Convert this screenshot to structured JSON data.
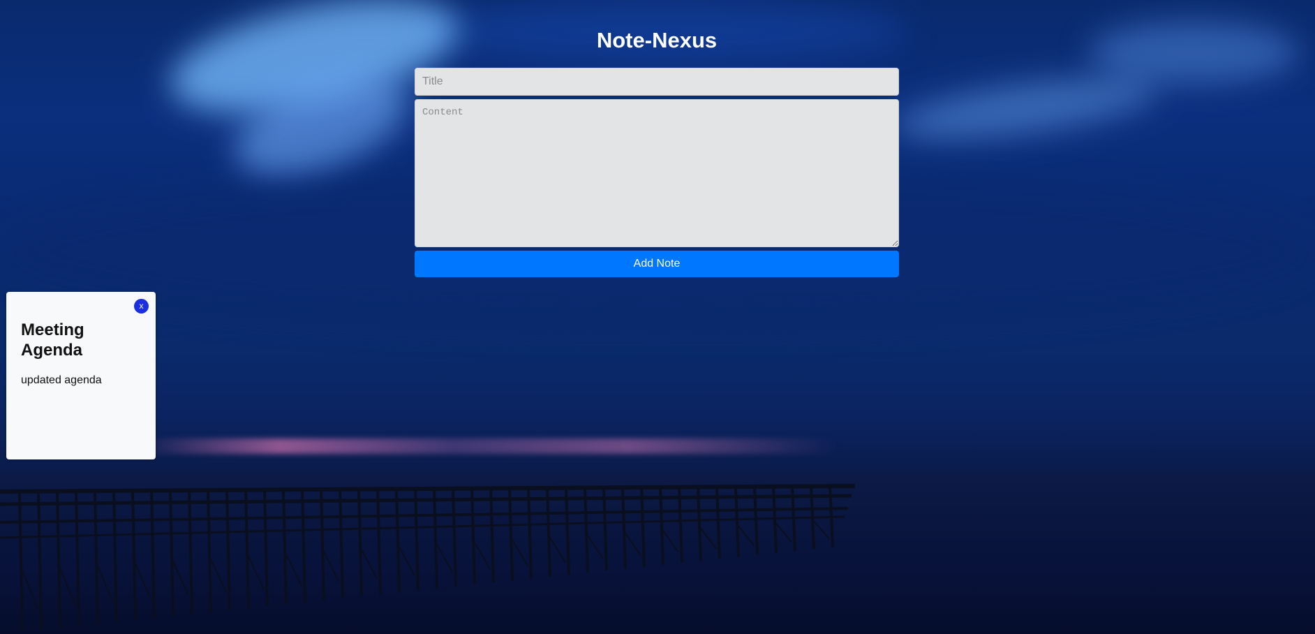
{
  "app": {
    "title": "Note-Nexus"
  },
  "form": {
    "title_placeholder": "Title",
    "title_value": "",
    "content_placeholder": "Content",
    "content_value": "",
    "add_label": "Add Note"
  },
  "notes": [
    {
      "title": "Meeting Agenda",
      "content": "updated agenda",
      "close_label": "x"
    }
  ],
  "colors": {
    "accent": "#0077ff",
    "close_button": "#1a2fe0",
    "input_background": "#e3e4e6",
    "card_background": "#f8f9fb"
  },
  "background": {
    "description_icon": "night-sky-pier-background"
  }
}
